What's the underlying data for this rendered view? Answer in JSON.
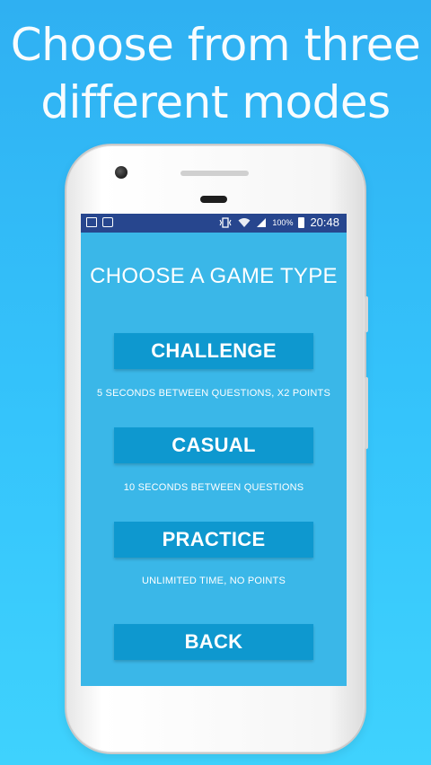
{
  "promo": {
    "line1": "Choose from three",
    "line2": "different modes"
  },
  "status_bar": {
    "left_icons": [
      "image-icon",
      "briefcase-icon"
    ],
    "right_icons": [
      "vibrate-icon",
      "wifi-icon",
      "signal-icon",
      "battery-icon"
    ],
    "battery_text": "100%",
    "time": "20:48"
  },
  "screen": {
    "title": "CHOOSE A GAME TYPE",
    "modes": [
      {
        "label": "CHALLENGE",
        "description": "5 SECONDS BETWEEN QUESTIONS, X2 POINTS"
      },
      {
        "label": "CASUAL",
        "description": "10 SECONDS BETWEEN QUESTIONS"
      },
      {
        "label": "PRACTICE",
        "description": "UNLIMITED TIME, NO POINTS"
      }
    ],
    "back_label": "BACK"
  },
  "colors": {
    "background": "#35c4fb",
    "screen": "#3ab7e8",
    "button": "#0e98cf",
    "status_bar": "#27468e"
  }
}
